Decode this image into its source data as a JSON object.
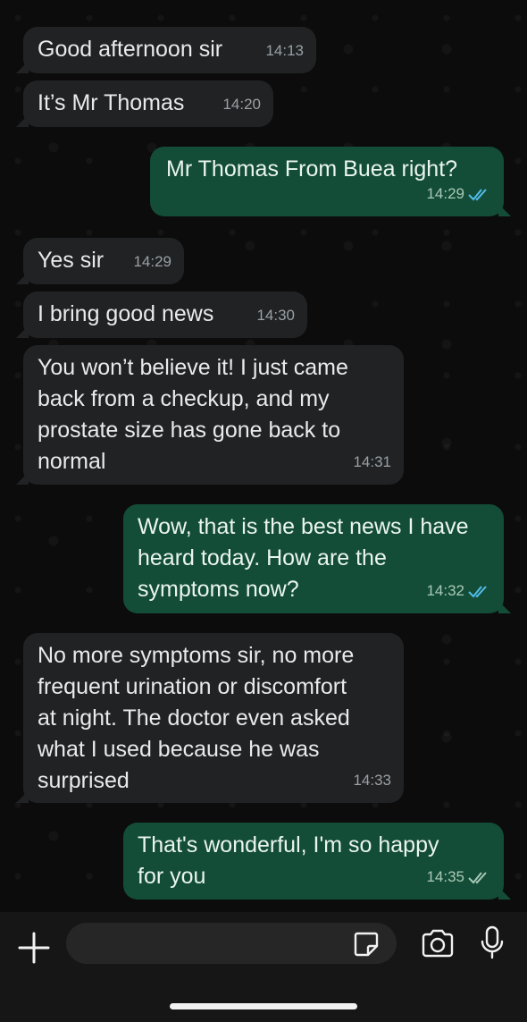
{
  "messages": [
    {
      "direction": "in",
      "text": "Good afternoon sir",
      "time": "14:13"
    },
    {
      "direction": "in",
      "text": "It’s Mr Thomas",
      "time": "14:20"
    },
    {
      "direction": "out",
      "text": "Mr Thomas From Buea right?",
      "time": "14:29",
      "status": "read"
    },
    {
      "direction": "in",
      "text": "Yes sir",
      "time": "14:29"
    },
    {
      "direction": "in",
      "text": "I bring good news",
      "time": "14:30"
    },
    {
      "direction": "in",
      "text": "You won’t believe it! I just came\nback from a checkup, and my\nprostate size has gone back to\nnormal",
      "time": "14:31"
    },
    {
      "direction": "out",
      "text": "Wow, that is the best news I have\nheard today. How are the\nsymptoms now?",
      "time": "14:32",
      "status": "read"
    },
    {
      "direction": "in",
      "text": "No more symptoms sir, no more\nfrequent urination or discomfort\nat night. The doctor even asked\nwhat I used because he was\nsurprised",
      "time": "14:33"
    },
    {
      "direction": "out",
      "text": "That's wonderful, I'm so happy\nfor you",
      "time": "14:35",
      "status": "delivered"
    }
  ],
  "composer": {
    "message_value": "",
    "icons": [
      "plus-icon",
      "sticker-icon",
      "camera-icon",
      "microphone-icon"
    ]
  },
  "colors": {
    "incoming_bubble": "#202224",
    "outgoing_bubble": "#134d37",
    "read_tick": "#53bdeb",
    "delivered_tick": "#a9c9b8"
  }
}
